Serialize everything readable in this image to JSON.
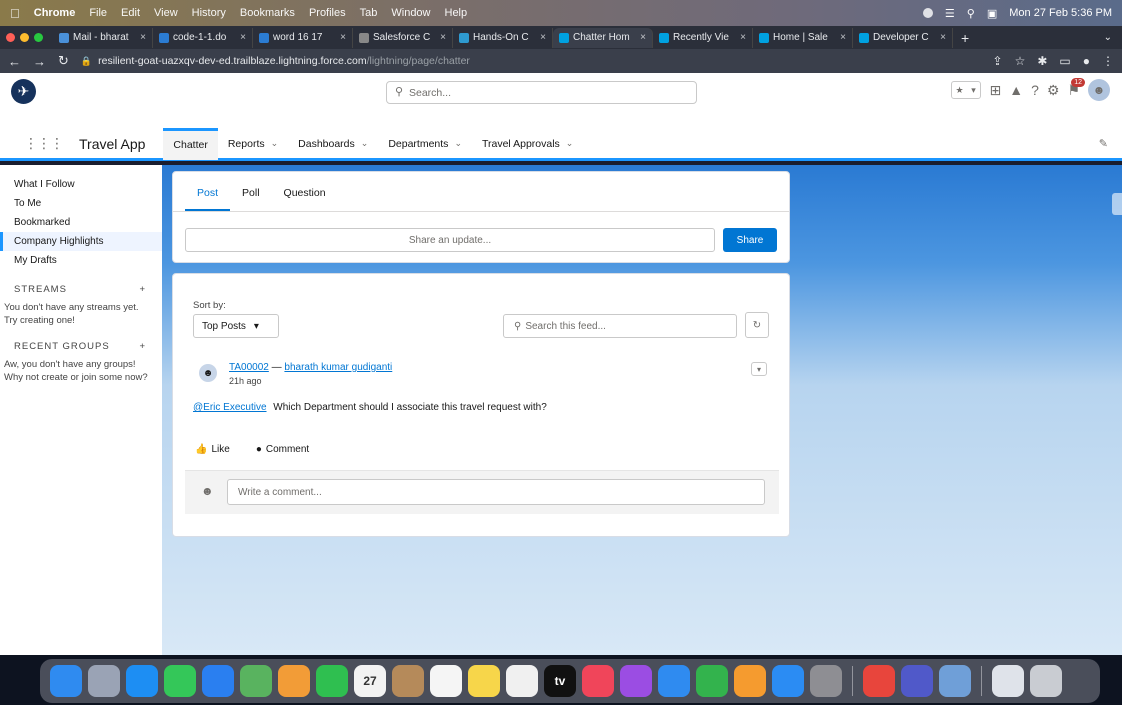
{
  "menubar": {
    "app": "Chrome",
    "items": [
      "File",
      "Edit",
      "View",
      "History",
      "Bookmarks",
      "Profiles",
      "Tab",
      "Window",
      "Help"
    ],
    "clock": "Mon 27 Feb 5:36 PM"
  },
  "tabs": [
    {
      "label": "Mail - bharat",
      "color": "#4a90d9"
    },
    {
      "label": "code-1-1.do",
      "color": "#2b7cd3"
    },
    {
      "label": "word 16 17",
      "color": "#2b7cd3"
    },
    {
      "label": "Salesforce C",
      "color": "#888888"
    },
    {
      "label": "Hands-On C",
      "color": "#2e9ad0"
    },
    {
      "label": "Chatter Hom",
      "color": "#00a1e0",
      "active": true
    },
    {
      "label": "Recently Vie",
      "color": "#00a1e0"
    },
    {
      "label": "Home | Sale",
      "color": "#00a1e0"
    },
    {
      "label": "Developer C",
      "color": "#00a1e0"
    }
  ],
  "address": {
    "host": "resilient-goat-uazxqv-dev-ed.trailblaze.lightning.force.com",
    "path": "/lightning/page/chatter"
  },
  "header": {
    "search_placeholder": "Search...",
    "notification_count": "12"
  },
  "nav": {
    "app_name": "Travel App",
    "items": [
      {
        "label": "Chatter",
        "active": true,
        "dropdown": false
      },
      {
        "label": "Reports",
        "dropdown": true
      },
      {
        "label": "Dashboards",
        "dropdown": true
      },
      {
        "label": "Departments",
        "dropdown": true
      },
      {
        "label": "Travel Approvals",
        "dropdown": true
      }
    ]
  },
  "sidebar": {
    "links": [
      "What I Follow",
      "To Me",
      "Bookmarked",
      "Company Highlights",
      "My Drafts"
    ],
    "active_index": 3,
    "streams_title": "STREAMS",
    "streams_note": "You don't have any streams yet. Try creating one!",
    "groups_title": "RECENT GROUPS",
    "groups_note": "Aw, you don't have any groups! Why not create or join some now?"
  },
  "composer": {
    "tabs": [
      "Post",
      "Poll",
      "Question"
    ],
    "placeholder": "Share an update...",
    "share_label": "Share"
  },
  "feed": {
    "sort_label": "Sort by:",
    "sort_value": "Top Posts",
    "search_placeholder": "Search this feed...",
    "post": {
      "record": "TA00002",
      "separator": "—",
      "author": "bharath kumar gudiganti",
      "time": "21h ago",
      "mention": "@Eric Executive",
      "text": "Which Department should I associate this travel request with?",
      "like_label": "Like",
      "comment_label": "Comment",
      "comment_placeholder": "Write a comment..."
    }
  },
  "dock": {
    "calendar_day": "27",
    "icons": [
      {
        "name": "finder",
        "color": "#2f8bf0"
      },
      {
        "name": "launchpad",
        "color": "#9aa3b5"
      },
      {
        "name": "safari",
        "color": "#1d8ef3"
      },
      {
        "name": "messages",
        "color": "#34c759"
      },
      {
        "name": "mail",
        "color": "#2a7ff0"
      },
      {
        "name": "maps",
        "color": "#59b35f"
      },
      {
        "name": "photos",
        "color": "#f29c37"
      },
      {
        "name": "facetime",
        "color": "#2fbf50"
      },
      {
        "name": "calendar",
        "color": "#f2f2f2"
      },
      {
        "name": "contacts",
        "color": "#b58a5a"
      },
      {
        "name": "reminders",
        "color": "#f5f5f5"
      },
      {
        "name": "notes",
        "color": "#f7d64a"
      },
      {
        "name": "freeform",
        "color": "#f0f0f0"
      },
      {
        "name": "tv",
        "color": "#111111"
      },
      {
        "name": "music",
        "color": "#f0455a"
      },
      {
        "name": "podcasts",
        "color": "#9b4de3"
      },
      {
        "name": "keynote",
        "color": "#2f8bf0"
      },
      {
        "name": "numbers",
        "color": "#33b34d"
      },
      {
        "name": "pages",
        "color": "#f59b2f"
      },
      {
        "name": "app-store",
        "color": "#2b8cf3"
      },
      {
        "name": "system-settings",
        "color": "#8e8e93"
      },
      {
        "name": "chrome",
        "color": "#e8453c"
      },
      {
        "name": "teams",
        "color": "#5059c9"
      },
      {
        "name": "preview",
        "color": "#6f9fd8"
      },
      {
        "name": "downloads",
        "color": "#dfe3ea"
      },
      {
        "name": "trash",
        "color": "#c9ccd2"
      }
    ]
  }
}
